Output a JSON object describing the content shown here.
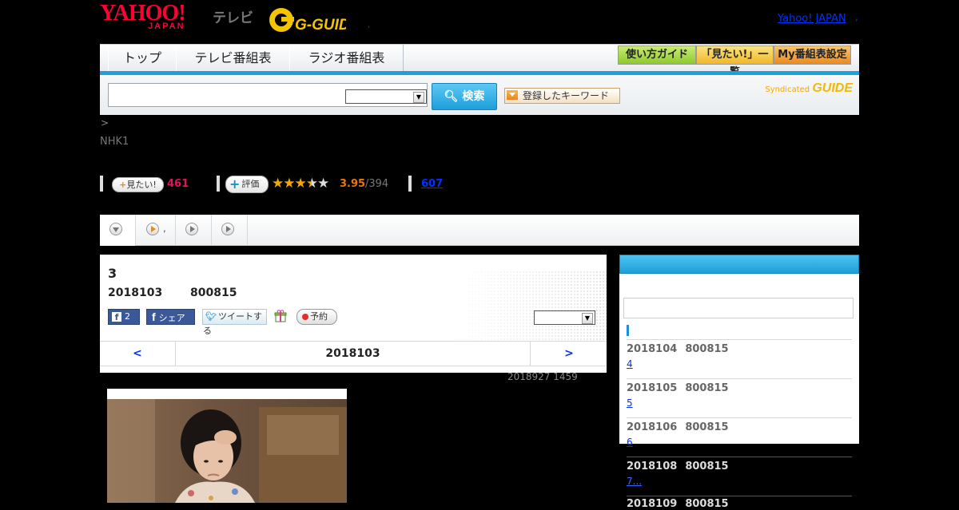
{
  "header": {
    "yahoo_logo": "YAHOO!",
    "yahoo_logo_sub": "JAPAN",
    "tv_label": "テレビ",
    "gguide_logo": "G-GUIDE",
    "small_mark": ",",
    "yahoo_japan_link": "Yahoo! JAPAN",
    "trailing_link": ","
  },
  "nav": {
    "tabs": [
      {
        "label": "トップ"
      },
      {
        "label": "テレビ番組表"
      },
      {
        "label": "ラジオ番組表"
      }
    ],
    "guide_buttons": [
      {
        "label": "使い方ガイド",
        "color": "#a9d94a"
      },
      {
        "label": "「見たい!」一覧",
        "color": "#f6c64b"
      },
      {
        "label": "My番組表設定",
        "color": "#f29a2e"
      }
    ],
    "accent_color": "#1ea0e0"
  },
  "search": {
    "placeholder": "",
    "value": "",
    "select_value": "",
    "button_label": "検索",
    "keyword_button_label": "登録したキーワード",
    "syndicated_label": "Syndicated",
    "syndicated_logo": "GUIDE"
  },
  "breadcrumb": " >",
  "channel": "NHK1",
  "stats": {
    "mitai_label": "見たい!",
    "mitai_count": "461",
    "hyoka_label": "評価",
    "rating_value": 3.95,
    "rating_text": "3.95",
    "rating_count": "/394",
    "review_count": "607",
    "star_color": "#f5a700"
  },
  "subtabs": [
    {
      "label": "",
      "icon": "down-circle-icon"
    },
    {
      "label": ",",
      "icon": "play-circle-icon"
    },
    {
      "label": "",
      "icon": "play-circle-icon"
    },
    {
      "label": "",
      "icon": "play-circle-icon"
    }
  ],
  "program": {
    "title": "3",
    "date": "2018103",
    "time": "800815",
    "fb_like_count": "2",
    "fb_share_label": "シェア",
    "tweet_label": "ツイートする",
    "yoyaku_label": "予約",
    "select_value": "",
    "date_nav": {
      "prev": "<",
      "current": "2018103",
      "next": ">"
    },
    "updated": "2018927  1459"
  },
  "sidebar": {
    "search_value": "",
    "episodes": [
      {
        "date": "2018104",
        "time": "800815",
        "link": "4"
      },
      {
        "date": "2018105",
        "time": "800815",
        "link": "5"
      },
      {
        "date": "2018106",
        "time": "800815",
        "link": "6"
      },
      {
        "date": "2018108",
        "time": "800815",
        "link": "7..."
      },
      {
        "date": "2018109",
        "time": "800815",
        "link": ""
      }
    ]
  }
}
